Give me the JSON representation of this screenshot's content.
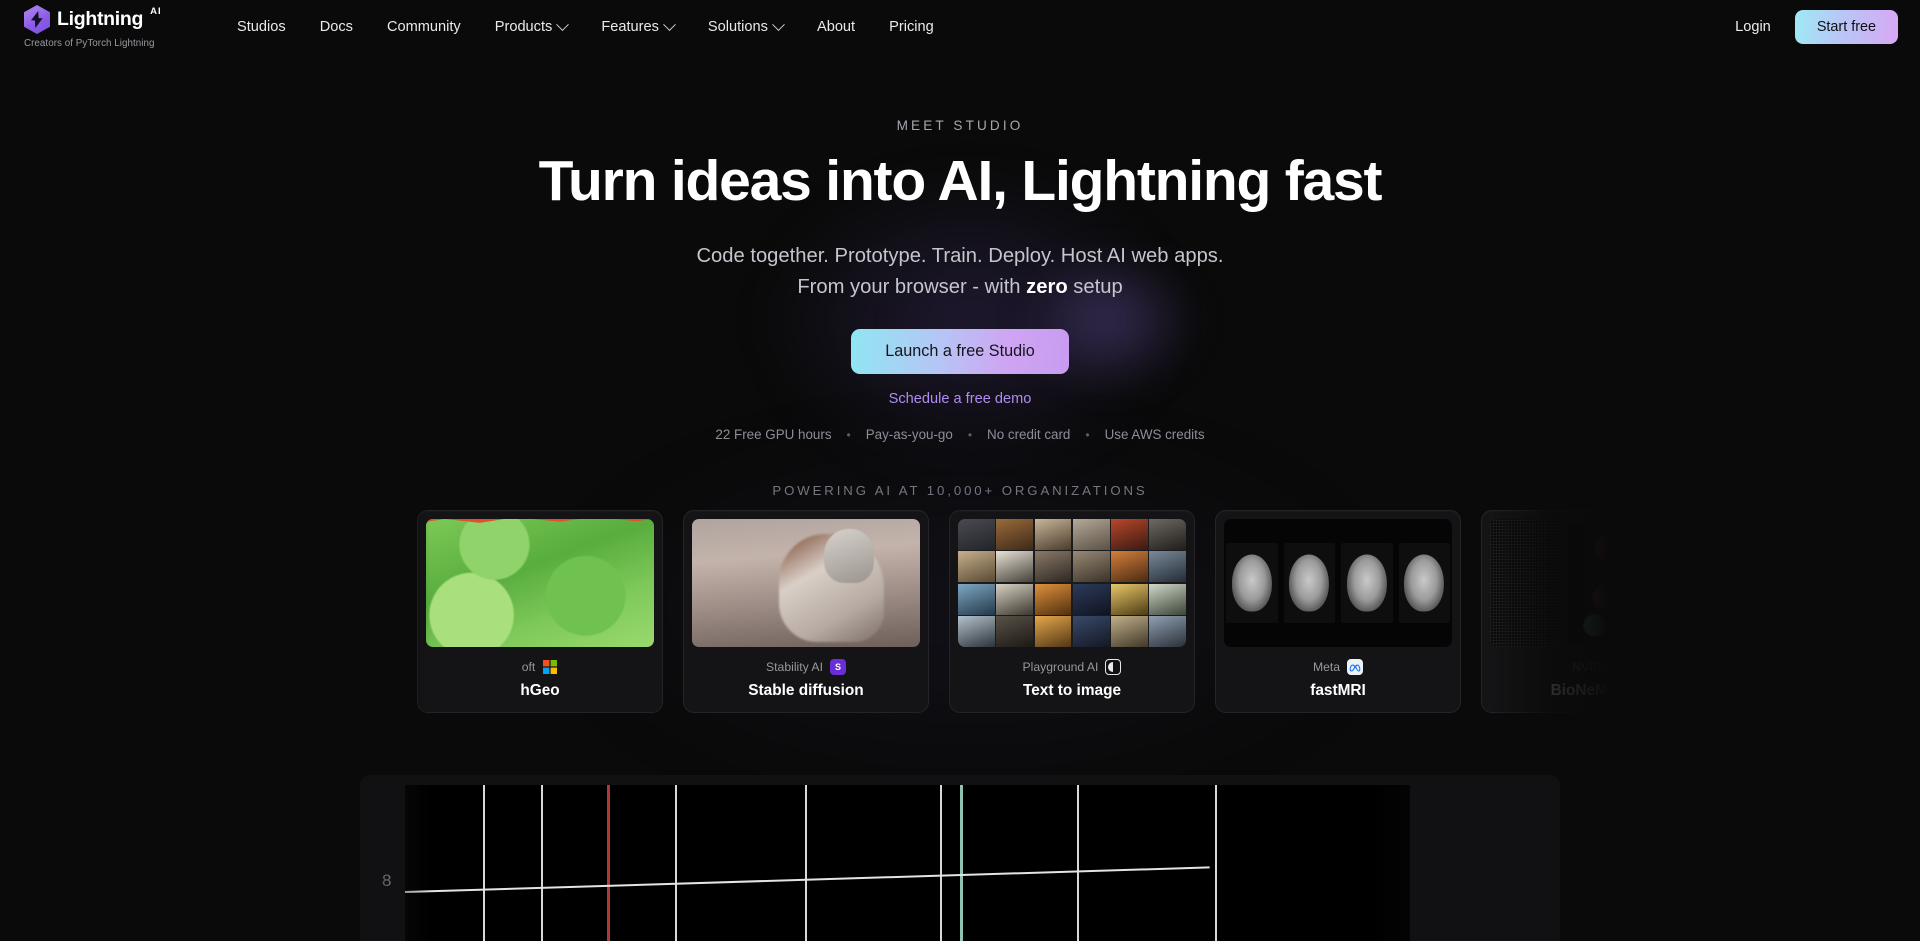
{
  "brand": {
    "name": "Lightning",
    "superscript": "AI",
    "tagline": "Creators of PyTorch Lightning",
    "logo_icon": "lightning-bolt-icon"
  },
  "nav": {
    "links": [
      {
        "label": "Studios",
        "has_dropdown": false
      },
      {
        "label": "Docs",
        "has_dropdown": false
      },
      {
        "label": "Community",
        "has_dropdown": false
      },
      {
        "label": "Products",
        "has_dropdown": true
      },
      {
        "label": "Features",
        "has_dropdown": true
      },
      {
        "label": "Solutions",
        "has_dropdown": true
      },
      {
        "label": "About",
        "has_dropdown": false
      },
      {
        "label": "Pricing",
        "has_dropdown": false
      }
    ],
    "login_label": "Login",
    "start_free_label": "Start free"
  },
  "hero": {
    "eyebrow": "MEET STUDIO",
    "headline": "Turn ideas into AI, Lightning fast",
    "sub_line1": "Code together. Prototype. Train. Deploy. Host AI web apps.",
    "sub_line2_before": "From your browser - with ",
    "sub_line2_bold": "zero",
    "sub_line2_after": " setup",
    "cta_label": "Launch a free Studio",
    "demo_label": "Schedule a free demo",
    "perks": [
      "22 Free GPU hours",
      "Pay-as-you-go",
      "No credit card",
      "Use AWS credits"
    ],
    "perk_separator": "•"
  },
  "social_proof": {
    "heading": "POWERING AI AT 10,000+ ORGANIZATIONS"
  },
  "carousel": {
    "cards": [
      {
        "vendor": "Microsoft",
        "vendor_visible": "oft",
        "title": "TorchGeo",
        "title_visible": "hGeo",
        "badge_icon": "microsoft-logo-icon",
        "thumb": "satellite-vegetation-map"
      },
      {
        "vendor": "Stability AI",
        "vendor_visible": "Stability AI",
        "title": "Stable diffusion",
        "title_visible": "Stable diffusion",
        "badge_icon": "stability-ai-logo-icon",
        "thumb": "astronaut-on-horse"
      },
      {
        "vendor": "Playground AI",
        "vendor_visible": "Playground AI",
        "title": "Text to image",
        "title_visible": "Text to image",
        "badge_icon": "playground-ai-logo-icon",
        "thumb": "generated-portrait-grid"
      },
      {
        "vendor": "Meta",
        "vendor_visible": "Meta",
        "title": "fastMRI",
        "title_visible": "fastMRI",
        "badge_icon": "meta-logo-icon",
        "thumb": "brain-mri-slices"
      },
      {
        "vendor": "NVIDIA",
        "vendor_visible": "NVIDIA",
        "title": "BioNeMo - Drug discovery",
        "title_visible": "BioNeMo - Dru",
        "badge_icon": "nvidia-logo-icon",
        "thumb": "protein-ribbon-structure"
      }
    ]
  },
  "viz": {
    "y_axis_label": "8",
    "marker_red": "red-vertical-marker",
    "marker_teal": "teal-vertical-marker"
  },
  "colors": {
    "page_background": "#0a0a0a",
    "card_background": "#141416",
    "accent_purple": "#b08cf0",
    "cta_gradient_start": "#8fe6f2",
    "cta_gradient_end": "#cfa4f2",
    "muted_text": "#8e8e98"
  }
}
